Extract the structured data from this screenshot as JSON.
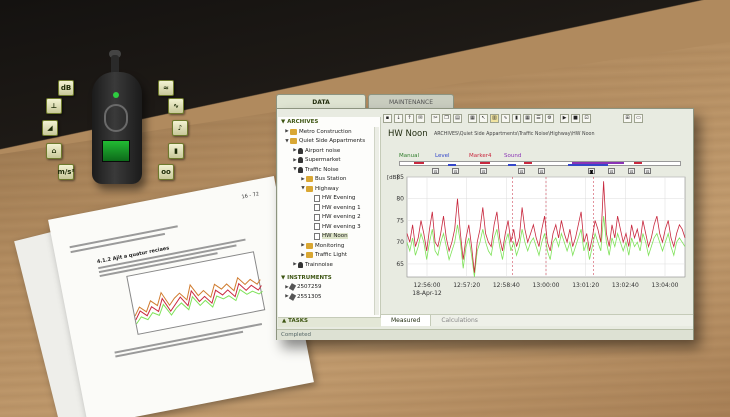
{
  "colors": {
    "accent_green": "#3d5512",
    "series_red": "#c8283e",
    "series_green": "#7fe25a",
    "marker_manual": "#2f7d2b",
    "marker_level": "#3447c9",
    "marker_marker4": "#c8283e",
    "marker_sound": "#8a33b5"
  },
  "scene": {
    "meter_icons": [
      "dB",
      "",
      "",
      "",
      "",
      "m/s²",
      "",
      "",
      "",
      "",
      ""
    ],
    "document": {
      "page_number": "16 - 72",
      "heading": "4.1.2   Ajit a quatur reciaes"
    }
  },
  "window": {
    "tabs": [
      {
        "label": "DATA",
        "active": true
      },
      {
        "label": "MAINTENANCE",
        "active": false
      }
    ],
    "archives_header": "ARCHIVES",
    "tree": [
      {
        "label": "Metro Construction",
        "level": 0,
        "icon": "folder",
        "arrow": "▶"
      },
      {
        "label": "Quiet Side Appartments",
        "level": 0,
        "icon": "folder",
        "arrow": "▼"
      },
      {
        "label": "Airport noise",
        "level": 1,
        "icon": "person",
        "arrow": "▶"
      },
      {
        "label": "Supermarket",
        "level": 1,
        "icon": "person",
        "arrow": "▶"
      },
      {
        "label": "Traffic Noise",
        "level": 1,
        "icon": "person",
        "arrow": "▼"
      },
      {
        "label": "Bus Station",
        "level": 2,
        "icon": "folder",
        "arrow": "▶"
      },
      {
        "label": "Highway",
        "level": 2,
        "icon": "folder",
        "arrow": "▼"
      },
      {
        "label": "HW Evening",
        "level": 3,
        "icon": "file",
        "arrow": ""
      },
      {
        "label": "HW evening 1",
        "level": 3,
        "icon": "file",
        "arrow": ""
      },
      {
        "label": "HW evening 2",
        "level": 3,
        "icon": "file",
        "arrow": ""
      },
      {
        "label": "HW evening 3",
        "level": 3,
        "icon": "file",
        "arrow": ""
      },
      {
        "label": "HW Noon",
        "level": 3,
        "icon": "file",
        "arrow": "",
        "selected": true
      },
      {
        "label": "Monitoring",
        "level": 2,
        "icon": "folder",
        "arrow": "▶"
      },
      {
        "label": "Traffic Light",
        "level": 2,
        "icon": "folder",
        "arrow": "▶"
      },
      {
        "label": "Trainnoise",
        "level": 1,
        "icon": "person",
        "arrow": "▶"
      }
    ],
    "instruments_header": "INSTRUMENTS",
    "instruments": [
      {
        "label": "2507259"
      },
      {
        "label": "2551305"
      }
    ],
    "tasks_label": "TASKS",
    "status": "Completed",
    "main_title": "HW Noon",
    "breadcrumb": "ARCHIVES\\Quiet Side Appartments\\Traffic Noise\\Highway\\HW Noon",
    "markers": [
      {
        "label": "Manual",
        "color": "#2f7d2b"
      },
      {
        "label": "Level",
        "color": "#3447c9"
      },
      {
        "label": "Marker4",
        "color": "#c8283e"
      },
      {
        "label": "Sound",
        "color": "#8a33b5"
      }
    ],
    "bottom_tabs": [
      {
        "label": "Measured",
        "active": true
      },
      {
        "label": "Calculations",
        "active": false
      }
    ]
  },
  "chart_data": {
    "type": "line",
    "ylabel": "[dB]",
    "ylim": [
      62,
      85
    ],
    "yticks": [
      65,
      70,
      75,
      80,
      85
    ],
    "x_tick_labels": [
      "12:56:00",
      "12:57:20",
      "12:58:40",
      "13:00:00",
      "13:01:20",
      "13:02:40",
      "13:04:00"
    ],
    "x_date_label": "18-Apr-12",
    "grid": true,
    "series": [
      {
        "color": "#c8283e",
        "values": [
          72,
          70,
          74,
          69,
          71,
          75,
          72,
          68,
          73,
          77,
          70,
          69,
          72,
          76,
          71,
          68,
          70,
          73,
          80,
          72,
          66,
          71,
          74,
          69,
          63,
          70,
          73,
          78,
          72,
          70,
          69,
          74,
          77,
          71,
          68,
          72,
          75,
          70,
          73,
          69,
          71,
          78,
          73,
          70,
          72,
          74,
          71,
          69,
          73,
          76,
          70,
          68,
          72,
          74,
          71,
          75,
          72,
          70,
          73,
          69,
          71,
          74,
          77,
          70,
          72,
          68,
          71,
          75,
          73,
          70,
          84,
          72,
          69,
          74,
          71,
          76,
          73,
          70,
          72,
          69,
          74,
          71,
          73,
          70,
          75,
          72,
          69,
          71,
          74,
          76,
          72,
          70,
          73,
          75,
          71,
          69,
          72,
          74,
          73,
          71
        ]
      },
      {
        "color": "#7fe25a",
        "values": [
          70,
          68,
          71,
          67,
          69,
          72,
          70,
          66,
          70,
          73,
          68,
          67,
          70,
          72,
          69,
          66,
          68,
          70,
          74,
          70,
          64,
          69,
          71,
          67,
          62,
          68,
          70,
          73,
          70,
          68,
          67,
          71,
          73,
          69,
          66,
          70,
          72,
          68,
          70,
          67,
          69,
          73,
          70,
          68,
          70,
          71,
          69,
          67,
          70,
          72,
          68,
          66,
          70,
          71,
          69,
          72,
          70,
          68,
          70,
          67,
          69,
          71,
          73,
          68,
          70,
          66,
          69,
          72,
          70,
          68,
          76,
          70,
          67,
          71,
          69,
          72,
          70,
          68,
          70,
          67,
          71,
          69,
          70,
          68,
          72,
          70,
          67,
          69,
          71,
          72,
          70,
          68,
          70,
          72,
          69,
          67,
          70,
          71,
          70,
          69
        ]
      }
    ]
  }
}
